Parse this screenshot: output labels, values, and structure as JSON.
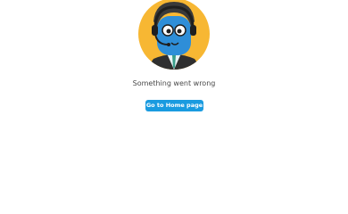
{
  "error": {
    "illustration": "support-agent-mascot-icon",
    "message": "Something went wrong",
    "home_button_label": "Go to Home page"
  },
  "colors": {
    "mascot_background": "#f7b733",
    "mascot_face": "#2e8ed8",
    "mascot_hair": "#3a3a3a",
    "button_background": "#1a9be0",
    "button_text": "#ffffff",
    "message_text": "#4a4a4a"
  }
}
